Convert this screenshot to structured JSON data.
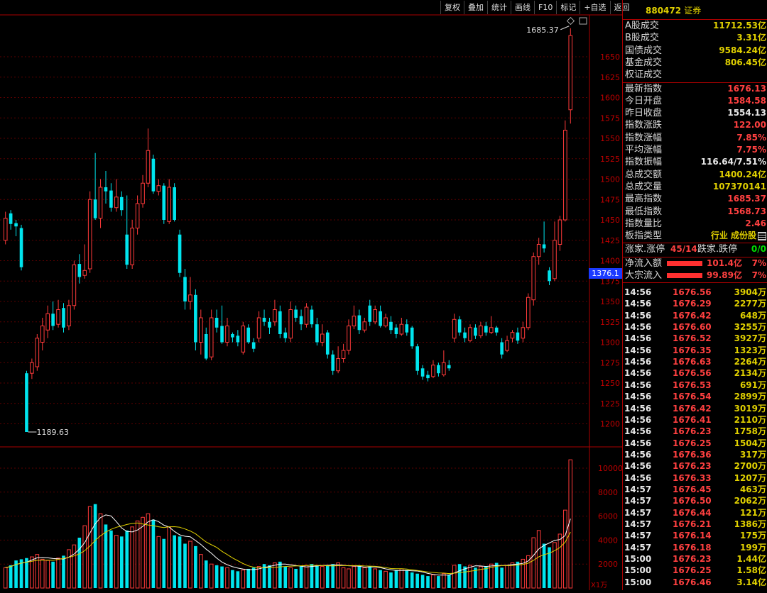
{
  "toolbar": [
    "复权",
    "叠加",
    "统计",
    "画线",
    "F10",
    "标记",
    "+自选",
    "返回"
  ],
  "chart": {
    "high_label": "1685.37",
    "low_label": "1189.63",
    "current_price_tag": "1376.1",
    "vol_unit": "X1万",
    "price_ticks": [
      "1650",
      "1625",
      "1600",
      "1575",
      "1550",
      "1525",
      "1500",
      "1475",
      "1450",
      "1425",
      "1400",
      "1375",
      "1350",
      "1325",
      "1300",
      "1275",
      "1250",
      "1225",
      "1200"
    ],
    "vol_ticks": [
      "10000",
      "8000",
      "6000",
      "4000",
      "2000"
    ]
  },
  "chart_data": {
    "type": "candlestick",
    "price_axis_range": [
      1175,
      1700
    ],
    "volume_axis_range": [
      0,
      11000
    ],
    "candles": [
      {
        "o": 1425,
        "c": 1452,
        "h": 1460,
        "l": 1420,
        "v": 1700
      },
      {
        "o": 1458,
        "c": 1445,
        "h": 1462,
        "l": 1438,
        "v": 1900
      },
      {
        "o": 1446,
        "c": 1442,
        "h": 1450,
        "l": 1430,
        "v": 2300
      },
      {
        "o": 1440,
        "c": 1392,
        "h": 1444,
        "l": 1388,
        "v": 2400
      },
      {
        "o": 1262,
        "c": 1190,
        "h": 1265,
        "l": 1190,
        "v": 2500
      },
      {
        "o": 1262,
        "c": 1275,
        "h": 1280,
        "l": 1255,
        "v": 2600
      },
      {
        "o": 1270,
        "c": 1305,
        "h": 1310,
        "l": 1265,
        "v": 2800
      },
      {
        "o": 1300,
        "c": 1320,
        "h": 1330,
        "l": 1290,
        "v": 2400
      },
      {
        "o": 1315,
        "c": 1335,
        "h": 1345,
        "l": 1305,
        "v": 2300
      },
      {
        "o": 1335,
        "c": 1320,
        "h": 1350,
        "l": 1315,
        "v": 2200
      },
      {
        "o": 1322,
        "c": 1340,
        "h": 1352,
        "l": 1318,
        "v": 2500
      },
      {
        "o": 1342,
        "c": 1318,
        "h": 1348,
        "l": 1312,
        "v": 2700
      },
      {
        "o": 1320,
        "c": 1345,
        "h": 1352,
        "l": 1315,
        "v": 3200
      },
      {
        "o": 1345,
        "c": 1395,
        "h": 1400,
        "l": 1340,
        "v": 3600
      },
      {
        "o": 1396,
        "c": 1380,
        "h": 1408,
        "l": 1372,
        "v": 4200
      },
      {
        "o": 1382,
        "c": 1388,
        "h": 1420,
        "l": 1378,
        "v": 5200
      },
      {
        "o": 1390,
        "c": 1475,
        "h": 1485,
        "l": 1385,
        "v": 6800
      },
      {
        "o": 1475,
        "c": 1452,
        "h": 1532,
        "l": 1450,
        "v": 7000
      },
      {
        "o": 1452,
        "c": 1490,
        "h": 1500,
        "l": 1440,
        "v": 6200
      },
      {
        "o": 1490,
        "c": 1485,
        "h": 1510,
        "l": 1470,
        "v": 5300
      },
      {
        "o": 1486,
        "c": 1465,
        "h": 1495,
        "l": 1460,
        "v": 4800
      },
      {
        "o": 1465,
        "c": 1478,
        "h": 1500,
        "l": 1460,
        "v": 4400
      },
      {
        "o": 1478,
        "c": 1462,
        "h": 1485,
        "l": 1455,
        "v": 4300
      },
      {
        "o": 1432,
        "c": 1395,
        "h": 1480,
        "l": 1390,
        "v": 4800
      },
      {
        "o": 1395,
        "c": 1440,
        "h": 1450,
        "l": 1390,
        "v": 5100
      },
      {
        "o": 1440,
        "c": 1470,
        "h": 1480,
        "l": 1432,
        "v": 5600
      },
      {
        "o": 1470,
        "c": 1495,
        "h": 1505,
        "l": 1465,
        "v": 5900
      },
      {
        "o": 1495,
        "c": 1535,
        "h": 1562,
        "l": 1490,
        "v": 6200
      },
      {
        "o": 1525,
        "c": 1485,
        "h": 1530,
        "l": 1482,
        "v": 5700
      },
      {
        "o": 1485,
        "c": 1492,
        "h": 1500,
        "l": 1480,
        "v": 4300
      },
      {
        "o": 1492,
        "c": 1450,
        "h": 1495,
        "l": 1445,
        "v": 4100
      },
      {
        "o": 1448,
        "c": 1490,
        "h": 1500,
        "l": 1445,
        "v": 5100
      },
      {
        "o": 1490,
        "c": 1450,
        "h": 1495,
        "l": 1448,
        "v": 4400
      },
      {
        "o": 1432,
        "c": 1385,
        "h": 1438,
        "l": 1380,
        "v": 4300
      },
      {
        "o": 1380,
        "c": 1350,
        "h": 1390,
        "l": 1340,
        "v": 3700
      },
      {
        "o": 1350,
        "c": 1358,
        "h": 1380,
        "l": 1340,
        "v": 3900
      },
      {
        "o": 1358,
        "c": 1300,
        "h": 1365,
        "l": 1290,
        "v": 3500
      },
      {
        "o": 1300,
        "c": 1330,
        "h": 1340,
        "l": 1285,
        "v": 2800
      },
      {
        "o": 1310,
        "c": 1280,
        "h": 1318,
        "l": 1278,
        "v": 2300
      },
      {
        "o": 1282,
        "c": 1330,
        "h": 1340,
        "l": 1278,
        "v": 2000
      },
      {
        "o": 1330,
        "c": 1318,
        "h": 1340,
        "l": 1312,
        "v": 1900
      },
      {
        "o": 1320,
        "c": 1300,
        "h": 1345,
        "l": 1298,
        "v": 1800
      },
      {
        "o": 1300,
        "c": 1320,
        "h": 1330,
        "l": 1295,
        "v": 1700
      },
      {
        "o": 1310,
        "c": 1306,
        "h": 1312,
        "l": 1300,
        "v": 1500
      },
      {
        "o": 1308,
        "c": 1300,
        "h": 1315,
        "l": 1295,
        "v": 1400
      },
      {
        "o": 1288,
        "c": 1320,
        "h": 1325,
        "l": 1285,
        "v": 1500
      },
      {
        "o": 1318,
        "c": 1300,
        "h": 1322,
        "l": 1298,
        "v": 1600
      },
      {
        "o": 1300,
        "c": 1292,
        "h": 1305,
        "l": 1288,
        "v": 1700
      },
      {
        "o": 1305,
        "c": 1330,
        "h": 1338,
        "l": 1300,
        "v": 1800
      },
      {
        "o": 1330,
        "c": 1325,
        "h": 1340,
        "l": 1320,
        "v": 2000
      },
      {
        "o": 1325,
        "c": 1318,
        "h": 1330,
        "l": 1310,
        "v": 1900
      },
      {
        "o": 1325,
        "c": 1340,
        "h": 1352,
        "l": 1320,
        "v": 2100
      },
      {
        "o": 1338,
        "c": 1310,
        "h": 1345,
        "l": 1305,
        "v": 2200
      },
      {
        "o": 1312,
        "c": 1305,
        "h": 1318,
        "l": 1300,
        "v": 1800
      },
      {
        "o": 1305,
        "c": 1340,
        "h": 1350,
        "l": 1300,
        "v": 1700
      },
      {
        "o": 1340,
        "c": 1330,
        "h": 1345,
        "l": 1325,
        "v": 1600
      },
      {
        "o": 1332,
        "c": 1322,
        "h": 1340,
        "l": 1315,
        "v": 1800
      },
      {
        "o": 1322,
        "c": 1343,
        "h": 1348,
        "l": 1318,
        "v": 1900
      },
      {
        "o": 1340,
        "c": 1322,
        "h": 1345,
        "l": 1318,
        "v": 2000
      },
      {
        "o": 1322,
        "c": 1300,
        "h": 1330,
        "l": 1296,
        "v": 1900
      },
      {
        "o": 1300,
        "c": 1310,
        "h": 1322,
        "l": 1295,
        "v": 1800
      },
      {
        "o": 1312,
        "c": 1285,
        "h": 1315,
        "l": 1280,
        "v": 1900
      },
      {
        "o": 1285,
        "c": 1265,
        "h": 1290,
        "l": 1260,
        "v": 2000
      },
      {
        "o": 1265,
        "c": 1280,
        "h": 1295,
        "l": 1262,
        "v": 2100
      },
      {
        "o": 1280,
        "c": 1290,
        "h": 1298,
        "l": 1275,
        "v": 1700
      },
      {
        "o": 1290,
        "c": 1320,
        "h": 1328,
        "l": 1285,
        "v": 1600
      },
      {
        "o": 1320,
        "c": 1332,
        "h": 1345,
        "l": 1316,
        "v": 1800
      },
      {
        "o": 1333,
        "c": 1315,
        "h": 1340,
        "l": 1310,
        "v": 1900
      },
      {
        "o": 1315,
        "c": 1325,
        "h": 1330,
        "l": 1312,
        "v": 1700
      },
      {
        "o": 1345,
        "c": 1325,
        "h": 1352,
        "l": 1320,
        "v": 1800
      },
      {
        "o": 1325,
        "c": 1340,
        "h": 1345,
        "l": 1322,
        "v": 1600
      },
      {
        "o": 1338,
        "c": 1320,
        "h": 1345,
        "l": 1318,
        "v": 1500
      },
      {
        "o": 1320,
        "c": 1330,
        "h": 1335,
        "l": 1318,
        "v": 1400
      },
      {
        "o": 1325,
        "c": 1315,
        "h": 1332,
        "l": 1310,
        "v": 1300
      },
      {
        "o": 1318,
        "c": 1310,
        "h": 1322,
        "l": 1305,
        "v": 1500
      },
      {
        "o": 1310,
        "c": 1322,
        "h": 1330,
        "l": 1308,
        "v": 1600
      },
      {
        "o": 1322,
        "c": 1312,
        "h": 1328,
        "l": 1308,
        "v": 1500
      },
      {
        "o": 1318,
        "c": 1295,
        "h": 1320,
        "l": 1292,
        "v": 1300
      },
      {
        "o": 1295,
        "c": 1265,
        "h": 1298,
        "l": 1260,
        "v": 1200
      },
      {
        "o": 1268,
        "c": 1258,
        "h": 1272,
        "l": 1254,
        "v": 1100
      },
      {
        "o": 1260,
        "c": 1256,
        "h": 1265,
        "l": 1252,
        "v": 1000
      },
      {
        "o": 1258,
        "c": 1272,
        "h": 1278,
        "l": 1256,
        "v": 1100
      },
      {
        "o": 1272,
        "c": 1262,
        "h": 1275,
        "l": 1258,
        "v": 1000
      },
      {
        "o": 1260,
        "c": 1275,
        "h": 1290,
        "l": 1258,
        "v": 1200
      },
      {
        "o": 1272,
        "c": 1268,
        "h": 1278,
        "l": 1265,
        "v": 1100
      },
      {
        "o": 1305,
        "c": 1328,
        "h": 1335,
        "l": 1300,
        "v": 1900
      },
      {
        "o": 1328,
        "c": 1312,
        "h": 1332,
        "l": 1308,
        "v": 2000
      },
      {
        "o": 1312,
        "c": 1305,
        "h": 1318,
        "l": 1300,
        "v": 1800
      },
      {
        "o": 1302,
        "c": 1318,
        "h": 1322,
        "l": 1300,
        "v": 1900
      },
      {
        "o": 1318,
        "c": 1308,
        "h": 1322,
        "l": 1304,
        "v": 1700
      },
      {
        "o": 1308,
        "c": 1320,
        "h": 1325,
        "l": 1305,
        "v": 1800
      },
      {
        "o": 1320,
        "c": 1312,
        "h": 1325,
        "l": 1308,
        "v": 1800
      },
      {
        "o": 1312,
        "c": 1318,
        "h": 1332,
        "l": 1310,
        "v": 2000
      },
      {
        "o": 1318,
        "c": 1312,
        "h": 1320,
        "l": 1308,
        "v": 2100
      },
      {
        "o": 1300,
        "c": 1285,
        "h": 1305,
        "l": 1280,
        "v": 1700
      },
      {
        "o": 1290,
        "c": 1302,
        "h": 1308,
        "l": 1288,
        "v": 1900
      },
      {
        "o": 1305,
        "c": 1312,
        "h": 1315,
        "l": 1300,
        "v": 2100
      },
      {
        "o": 1312,
        "c": 1302,
        "h": 1318,
        "l": 1298,
        "v": 2200
      },
      {
        "o": 1305,
        "c": 1318,
        "h": 1325,
        "l": 1300,
        "v": 2400
      },
      {
        "o": 1318,
        "c": 1355,
        "h": 1360,
        "l": 1315,
        "v": 2700
      },
      {
        "o": 1352,
        "c": 1405,
        "h": 1410,
        "l": 1345,
        "v": 4200
      },
      {
        "o": 1405,
        "c": 1420,
        "h": 1428,
        "l": 1395,
        "v": 4800
      },
      {
        "o": 1420,
        "c": 1415,
        "h": 1448,
        "l": 1410,
        "v": 3700
      },
      {
        "o": 1388,
        "c": 1375,
        "h": 1392,
        "l": 1370,
        "v": 3400
      },
      {
        "o": 1378,
        "c": 1425,
        "h": 1448,
        "l": 1375,
        "v": 3800
      },
      {
        "o": 1420,
        "c": 1450,
        "h": 1455,
        "l": 1412,
        "v": 4500
      },
      {
        "o": 1450,
        "c": 1560,
        "h": 1572,
        "l": 1448,
        "v": 6500
      },
      {
        "o": 1585,
        "c": 1676,
        "h": 1685,
        "l": 1568,
        "v": 10700
      }
    ]
  },
  "side": {
    "code": "880472",
    "name": "证券",
    "summary": [
      {
        "label": "A股成交",
        "value": "11712.53亿",
        "color": "#e0d000"
      },
      {
        "label": "B股成交",
        "value": "3.31亿",
        "color": "#e0d000"
      },
      {
        "label": "国债成交",
        "value": "9584.24亿",
        "color": "#e0d000"
      },
      {
        "label": "基金成交",
        "value": "806.45亿",
        "color": "#e0d000"
      },
      {
        "label": "权证成交",
        "value": "",
        "color": "#e0d000"
      }
    ],
    "stats": [
      {
        "label": "最新指数",
        "value": "1676.13",
        "color": "#ff4040"
      },
      {
        "label": "今日开盘",
        "value": "1584.58",
        "color": "#ff4040"
      },
      {
        "label": "昨日收盘",
        "value": "1554.13",
        "color": "#e8e8e8"
      },
      {
        "label": "指数涨跌",
        "value": "122.00",
        "color": "#ff4040"
      },
      {
        "label": "指数涨幅",
        "value": "7.85%",
        "color": "#ff4040"
      },
      {
        "label": "平均涨幅",
        "value": "7.75%",
        "color": "#ff4040"
      },
      {
        "label": "指数振幅",
        "value": "116.64/7.51%",
        "color": "#e8e8e8"
      },
      {
        "label": "总成交额",
        "value": "1400.24亿",
        "color": "#e0d000"
      },
      {
        "label": "总成交量",
        "value": "107370141",
        "color": "#e0d000"
      },
      {
        "label": "最高指数",
        "value": "1685.37",
        "color": "#ff4040"
      },
      {
        "label": "最低指数",
        "value": "1568.73",
        "color": "#ff4040"
      },
      {
        "label": "指数量比",
        "value": "2.46",
        "color": "#ff4040"
      },
      {
        "label": "板指类型",
        "value": "行业 成份股",
        "color": "#e0d000"
      }
    ],
    "updown": {
      "up_label": "涨家.涨停",
      "up_value": "45/14",
      "down_label": "跌家.跌停",
      "down_value": "0/0"
    },
    "flows": [
      {
        "label": "净流入额",
        "value": "101.4亿",
        "pct": "7%"
      },
      {
        "label": "大宗流入",
        "value": "99.89亿",
        "pct": "7%"
      }
    ],
    "ticks": [
      {
        "t": "14:56",
        "p": "1676.56",
        "v": "3904万"
      },
      {
        "t": "14:56",
        "p": "1676.29",
        "v": "2277万"
      },
      {
        "t": "14:56",
        "p": "1676.42",
        "v": "648万"
      },
      {
        "t": "14:56",
        "p": "1676.60",
        "v": "3255万"
      },
      {
        "t": "14:56",
        "p": "1676.52",
        "v": "3927万"
      },
      {
        "t": "14:56",
        "p": "1676.35",
        "v": "1323万"
      },
      {
        "t": "14:56",
        "p": "1676.63",
        "v": "2264万"
      },
      {
        "t": "14:56",
        "p": "1676.56",
        "v": "2134万"
      },
      {
        "t": "14:56",
        "p": "1676.53",
        "v": "691万"
      },
      {
        "t": "14:56",
        "p": "1676.54",
        "v": "2899万"
      },
      {
        "t": "14:56",
        "p": "1676.42",
        "v": "3019万"
      },
      {
        "t": "14:56",
        "p": "1676.41",
        "v": "2110万"
      },
      {
        "t": "14:56",
        "p": "1676.23",
        "v": "1758万"
      },
      {
        "t": "14:56",
        "p": "1676.25",
        "v": "1504万"
      },
      {
        "t": "14:56",
        "p": "1676.36",
        "v": "317万"
      },
      {
        "t": "14:56",
        "p": "1676.23",
        "v": "2700万"
      },
      {
        "t": "14:56",
        "p": "1676.33",
        "v": "1207万"
      },
      {
        "t": "14:57",
        "p": "1676.45",
        "v": "463万"
      },
      {
        "t": "14:57",
        "p": "1676.50",
        "v": "2062万"
      },
      {
        "t": "14:57",
        "p": "1676.44",
        "v": "121万"
      },
      {
        "t": "14:57",
        "p": "1676.21",
        "v": "1386万"
      },
      {
        "t": "14:57",
        "p": "1676.14",
        "v": "175万"
      },
      {
        "t": "14:57",
        "p": "1676.18",
        "v": "199万"
      },
      {
        "t": "15:00",
        "p": "1676.23",
        "v": "1.44亿"
      },
      {
        "t": "15:00",
        "p": "1676.25",
        "v": "1.58亿"
      },
      {
        "t": "15:00",
        "p": "1676.46",
        "v": "3.14亿"
      }
    ]
  }
}
